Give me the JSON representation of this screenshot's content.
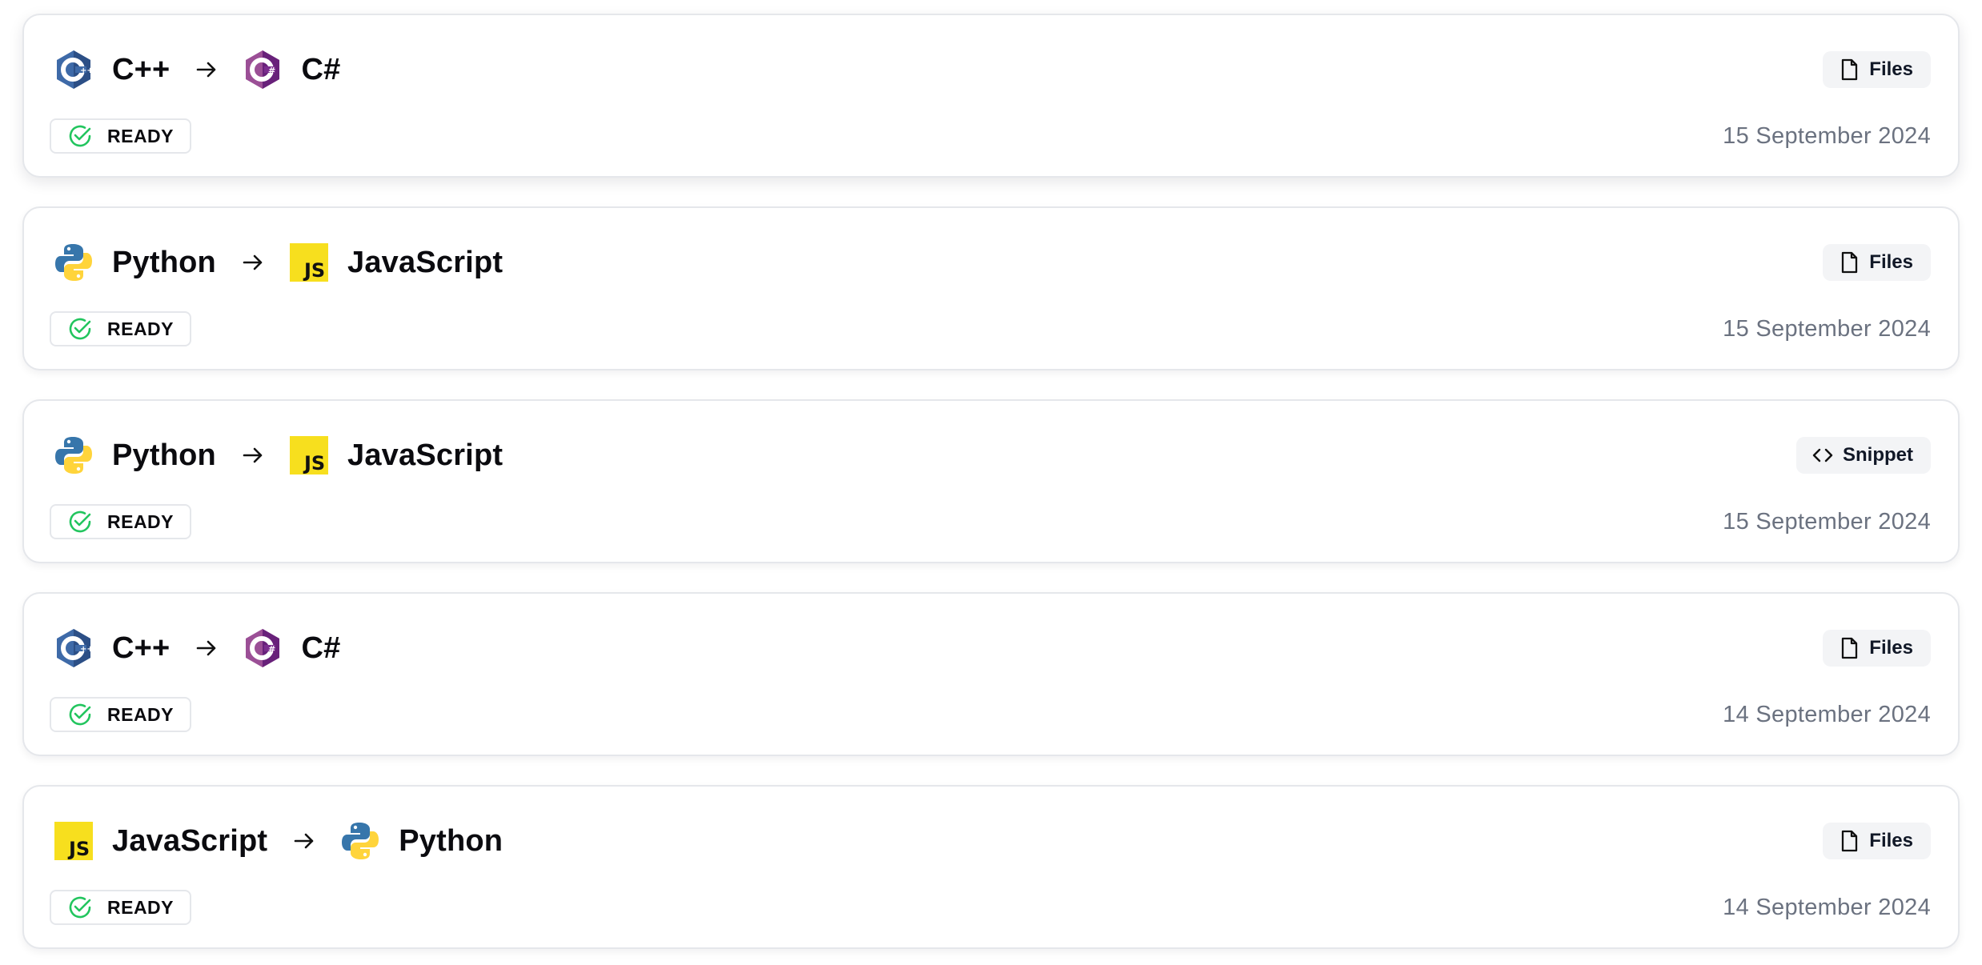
{
  "conversions": [
    {
      "source": {
        "name": "C++",
        "icon": "cpp-icon"
      },
      "target": {
        "name": "C#",
        "icon": "csharp-icon"
      },
      "type": {
        "label": "Files",
        "icon": "file-icon"
      },
      "status": {
        "label": "READY",
        "icon": "check-circle-icon"
      },
      "date": "15 September 2024"
    },
    {
      "source": {
        "name": "Python",
        "icon": "python-icon"
      },
      "target": {
        "name": "JavaScript",
        "icon": "javascript-icon"
      },
      "type": {
        "label": "Files",
        "icon": "file-icon"
      },
      "status": {
        "label": "READY",
        "icon": "check-circle-icon"
      },
      "date": "15 September 2024"
    },
    {
      "source": {
        "name": "Python",
        "icon": "python-icon"
      },
      "target": {
        "name": "JavaScript",
        "icon": "javascript-icon"
      },
      "type": {
        "label": "Snippet",
        "icon": "code-icon"
      },
      "status": {
        "label": "READY",
        "icon": "check-circle-icon"
      },
      "date": "15 September 2024"
    },
    {
      "source": {
        "name": "C++",
        "icon": "cpp-icon"
      },
      "target": {
        "name": "C#",
        "icon": "csharp-icon"
      },
      "type": {
        "label": "Files",
        "icon": "file-icon"
      },
      "status": {
        "label": "READY",
        "icon": "check-circle-icon"
      },
      "date": "14 September 2024"
    },
    {
      "source": {
        "name": "JavaScript",
        "icon": "javascript-icon"
      },
      "target": {
        "name": "Python",
        "icon": "python-icon"
      },
      "type": {
        "label": "Files",
        "icon": "file-icon"
      },
      "status": {
        "label": "READY",
        "icon": "check-circle-icon"
      },
      "date": "14 September 2024"
    }
  ],
  "colors": {
    "ready": "#22c55e",
    "cpp": "#3e6aa8",
    "csharp": "#7b2d8e",
    "python_blue": "#3776ab",
    "python_yellow": "#ffd43b",
    "javascript": "#f7df1e",
    "date_text": "#6b7280",
    "card_border": "#e5e7eb"
  }
}
